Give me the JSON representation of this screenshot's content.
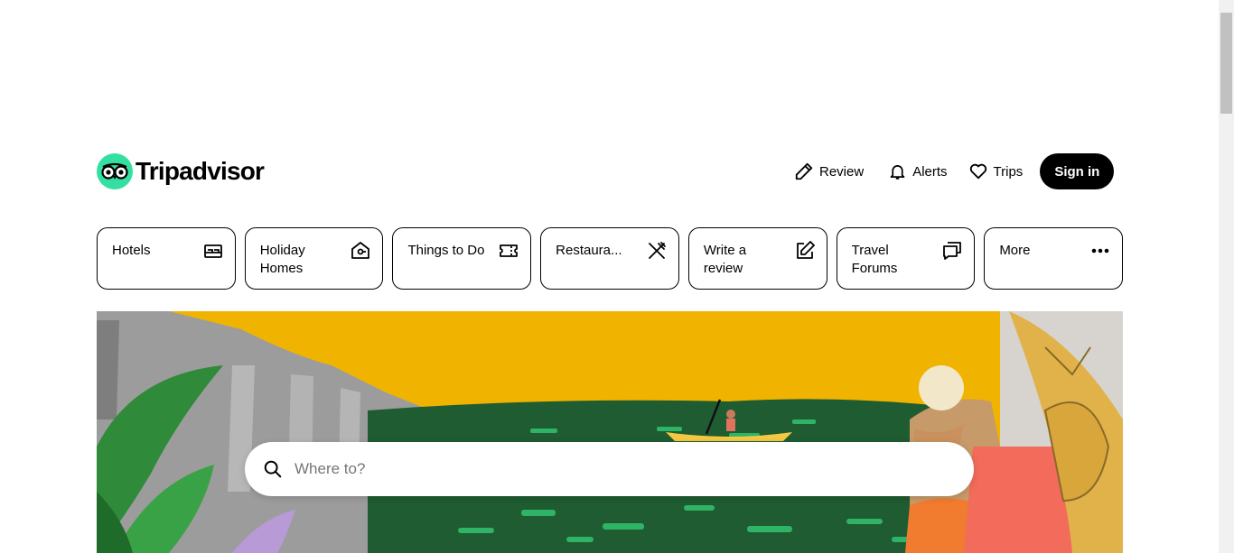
{
  "brand": {
    "name": "Tripadvisor",
    "accent": "#34e0a1"
  },
  "header": {
    "review_label": "Review",
    "alerts_label": "Alerts",
    "trips_label": "Trips",
    "signin_label": "Sign in"
  },
  "categories": [
    {
      "label": "Hotels",
      "icon": "bed-icon"
    },
    {
      "label": "Holiday Homes",
      "icon": "holiday-home-icon"
    },
    {
      "label": "Things to Do",
      "icon": "ticket-icon"
    },
    {
      "label": "Restaura...",
      "icon": "fork-knife-icon"
    },
    {
      "label": "Write a review",
      "icon": "edit-icon"
    },
    {
      "label": "Travel Forums",
      "icon": "forum-icon"
    },
    {
      "label": "More",
      "icon": "more-dots-icon"
    }
  ],
  "search": {
    "placeholder": "Where to?"
  },
  "colors": {
    "sky": "#f0b400",
    "lake": "#1e5a30",
    "mountain": "#9a9a9a",
    "jungle": "#2f8a3a"
  }
}
